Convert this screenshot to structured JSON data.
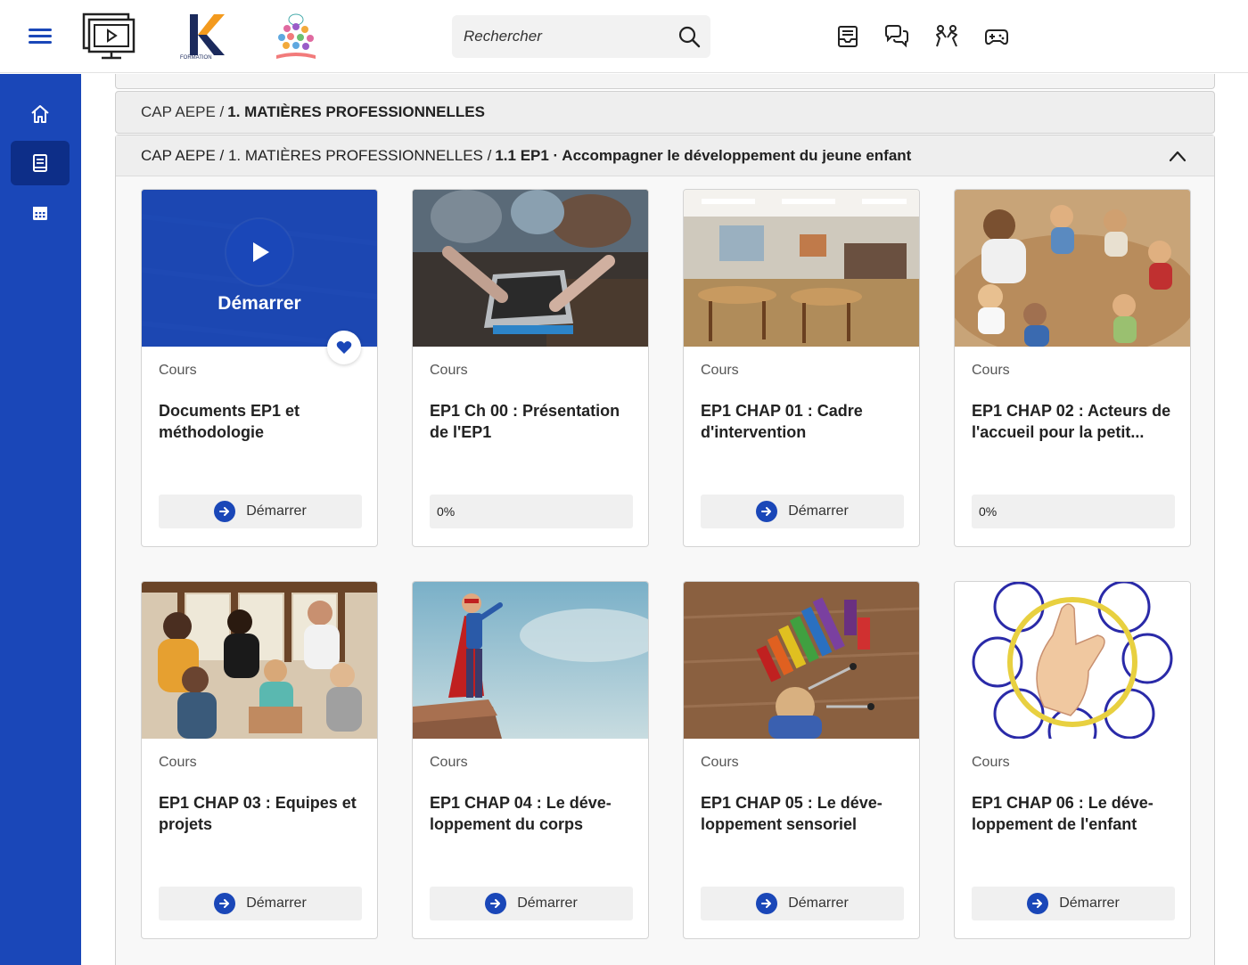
{
  "search": {
    "placeholder": "Rechercher"
  },
  "breadcrumb": {
    "root": "CAP AEPE /",
    "current": "1. MATIÈRES PROFESSIONNELLES"
  },
  "section": {
    "path": "CAP AEPE / 1. MATIÈRES PROFESSIONNELLES /",
    "title": "1.1 EP1 · Accompagner le développement du jeune enfant"
  },
  "overlay_label": "Démarrer",
  "cards": [
    {
      "type": "Cours",
      "title": "Documents EP1 et méthodologie",
      "action": "Démarrer",
      "progress": null
    },
    {
      "type": "Cours",
      "title": "EP1 Ch 00 : Présentation de l'EP1",
      "action": null,
      "progress_label": "0%",
      "progress": 0
    },
    {
      "type": "Cours",
      "title": "EP1 CHAP 01 : Cadre d'intervention",
      "action": "Démarrer",
      "progress": null
    },
    {
      "type": "Cours",
      "title": "EP1 CHAP 02 : Acteurs de l'accueil pour la petit...",
      "action": null,
      "progress_label": "0%",
      "progress": 0
    },
    {
      "type": "Cours",
      "title": "EP1 CHAP 03 : Equipes et projets",
      "action": "Démarrer",
      "progress": null
    },
    {
      "type": "Cours",
      "title": "EP1 CHAP 04 : Le déve-loppement du corps",
      "action": "Démarrer",
      "progress": null
    },
    {
      "type": "Cours",
      "title": "EP1 CHAP 05 : Le déve-loppement sensoriel",
      "action": "Démarrer",
      "progress": null
    },
    {
      "type": "Cours",
      "title": "EP1 CHAP 06 : Le déve-loppement de l'enfant",
      "action": "Démarrer",
      "progress": null
    }
  ],
  "colors": {
    "accent": "#1a47b8",
    "sidebar_active": "#0d2e88"
  },
  "icons": {
    "topbar": [
      "menu-icon",
      "screen-logo",
      "kesher-logo",
      "tree-logo",
      "search-icon",
      "inbox-icon",
      "chat-icon",
      "people-icon",
      "gamepad-icon"
    ],
    "sidebar": [
      "home-icon",
      "book-icon",
      "calendar-icon"
    ]
  }
}
